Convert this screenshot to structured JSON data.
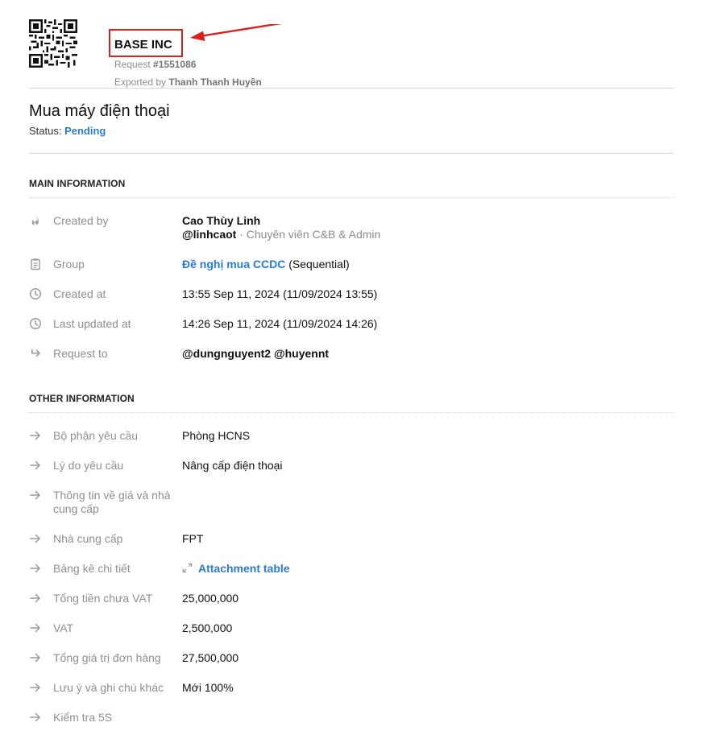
{
  "header": {
    "company": "BASE INC",
    "request_label": "Request",
    "request_id": "#1551086",
    "exported_by_label": "Exported by",
    "exported_by_name": "Thanh Thanh Huyền"
  },
  "request": {
    "title": "Mua máy điện thoại",
    "status_label": "Status:",
    "status_value": "Pending"
  },
  "main_information": {
    "section_title": "MAIN INFORMATION",
    "created_by": {
      "label": "Created by",
      "name": "Cao Thùy Linh",
      "handle": "@linhcaot",
      "separator": "·",
      "role": "Chuyên viên C&B & Admin",
      "icon": "flame-icon"
    },
    "group": {
      "label": "Group",
      "link": "Đề nghị mua CCDC",
      "suffix": "(Sequential)",
      "icon": "clipboard-icon"
    },
    "created_at": {
      "label": "Created at",
      "value": "13:55 Sep 11, 2024 (11/09/2024 13:55)",
      "icon": "clock-icon"
    },
    "last_updated_at": {
      "label": "Last updated at",
      "value": "14:26 Sep 11, 2024 (11/09/2024 14:26)",
      "icon": "clock-icon"
    },
    "request_to": {
      "label": "Request to",
      "value": "@dungnguyent2 @huyennt",
      "icon": "forward-arrow-icon"
    }
  },
  "other_information": {
    "section_title": "OTHER INFORMATION",
    "fields": [
      {
        "label": "Bộ phận yêu cầu",
        "value": "Phòng HCNS"
      },
      {
        "label": "Lý do yêu cầu",
        "value": "Nâng cấp điện thoại"
      },
      {
        "label": "Thông tin về giá và nhà cung cấp",
        "value": ""
      },
      {
        "label": "Nhà cung cấp",
        "value": "FPT"
      },
      {
        "label": "Bảng kê chi tiết",
        "value": "Attachment table"
      },
      {
        "label": "Tổng tiền chưa VAT",
        "value": "25,000,000"
      },
      {
        "label": "VAT",
        "value": "2,500,000"
      },
      {
        "label": "Tổng giá trị đơn hàng",
        "value": "27,500,000"
      },
      {
        "label": "Lưu ý và ghi chú khác",
        "value": "Mới 100%"
      },
      {
        "label": "Kiểm tra 5S",
        "value": ""
      }
    ]
  },
  "colors": {
    "link": "#2a7bd3",
    "highlight": "#d9201c",
    "muted": "#8f8f8f"
  }
}
